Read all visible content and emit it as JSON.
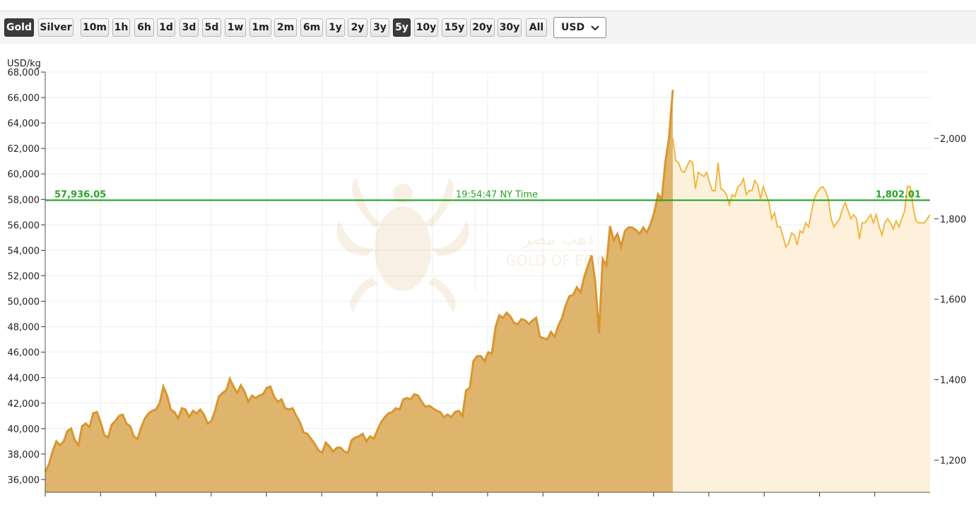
{
  "toolbar": {
    "metals": [
      {
        "label": "Gold",
        "active": true
      },
      {
        "label": "Silver",
        "active": false
      }
    ],
    "ranges": [
      {
        "label": "10m",
        "active": false
      },
      {
        "label": "1h",
        "active": false
      },
      {
        "label": "6h",
        "active": false
      },
      {
        "label": "1d",
        "active": false
      },
      {
        "label": "3d",
        "active": false
      },
      {
        "label": "5d",
        "active": false
      },
      {
        "label": "1w",
        "active": false
      },
      {
        "label": "1m",
        "active": false
      },
      {
        "label": "2m",
        "active": false
      },
      {
        "label": "6m",
        "active": false
      },
      {
        "label": "1y",
        "active": false
      },
      {
        "label": "2y",
        "active": false
      },
      {
        "label": "3y",
        "active": false
      },
      {
        "label": "5y",
        "active": true
      },
      {
        "label": "10y",
        "active": false
      },
      {
        "label": "15y",
        "active": false
      },
      {
        "label": "20y",
        "active": false
      },
      {
        "label": "30y",
        "active": false
      },
      {
        "label": "All",
        "active": false
      }
    ],
    "currency": "USD"
  },
  "watermark": {
    "arabic": "ذهب مصر",
    "english": "GOLD OF EGYPT"
  },
  "chart_data": {
    "type": "area",
    "ylabel": "USD/kg",
    "left_axis": {
      "ticks": [
        "36,000",
        "38,000",
        "40,000",
        "42,000",
        "44,000",
        "46,000",
        "48,000",
        "50,000",
        "52,000",
        "54,000",
        "56,000",
        "58,000",
        "60,000",
        "62,000",
        "64,000",
        "66,000",
        "68,000"
      ],
      "ylim": [
        35000,
        68000
      ]
    },
    "right_axis": {
      "ticks": [
        "1,200",
        "1,400",
        "1,600",
        "1,800",
        "2,000"
      ],
      "ylim": [
        1120,
        2165
      ]
    },
    "crosshair": {
      "left_value": "57,936.05",
      "right_value": "1,802.01",
      "time": "19:54:47 NY Time"
    },
    "x_tick_marks": 16,
    "colors": {
      "history_fill": "#dfb46c",
      "history_line": "#d9962f",
      "recent_fill": "#fdf1dc",
      "recent_line": "#f1b73f",
      "crosshair": "#1ea31e",
      "grid": "#eeeeee"
    },
    "series": [
      {
        "values": [
          36600,
          37200,
          38200,
          39000,
          38700,
          39000,
          39800,
          40000,
          39100,
          38700,
          40200,
          40400,
          40100,
          41200,
          41300,
          40500,
          39500,
          39300,
          40300,
          40600,
          41000,
          41100,
          40400,
          40200,
          39400,
          39200,
          40100,
          40800,
          41200,
          41400,
          41500,
          42000,
          43300,
          42600,
          41500,
          41300,
          40800,
          41600,
          41500,
          40900,
          41400,
          41200,
          41500,
          41100,
          40400,
          40600,
          41400,
          42500,
          42800,
          43000,
          43900,
          43300,
          42800,
          43400,
          42900,
          42100,
          42600,
          42400,
          42600,
          42700,
          43200,
          43300,
          42500,
          42100,
          42300,
          41600,
          41500,
          41600,
          41000,
          40500,
          39700,
          39600,
          39200,
          38800,
          38300,
          38100,
          38900,
          38600,
          38200,
          38500,
          38500,
          38200,
          38100,
          39100,
          39300,
          39400,
          39600,
          39000,
          39400,
          39200,
          39900,
          40500,
          40900,
          41200,
          41300,
          41600,
          41500,
          42300,
          42400,
          42300,
          42700,
          42600,
          42100,
          41700,
          41800,
          41600,
          41400,
          41300,
          40900,
          41100,
          40900,
          41300,
          41400,
          41000,
          43000,
          43200,
          45300,
          45700,
          45700,
          45300,
          46000,
          45900,
          48000,
          48900,
          48700,
          49100,
          48800,
          48300,
          48200,
          48600,
          48500,
          48200,
          48500,
          48700,
          47200,
          47100,
          47000,
          47600,
          47200,
          48100,
          48700,
          49700,
          50400,
          50500,
          51100,
          50700,
          51900,
          52800,
          53600,
          51500,
          47500,
          53300,
          52800,
          55900,
          54800,
          55300,
          54300,
          55500,
          55800,
          55800,
          55600,
          55300,
          55800,
          55400,
          56100,
          57000,
          58400,
          58000,
          61000,
          62900,
          66600
        ],
        "right_values": [
          2000,
          1945,
          1940,
          1920,
          1915,
          1930,
          1945,
          1940,
          1875,
          1915,
          1910,
          1905,
          1915,
          1890,
          1870,
          1870,
          1940,
          1875,
          1870,
          1860,
          1835,
          1860,
          1855,
          1880,
          1885,
          1900,
          1860,
          1870,
          1870,
          1895,
          1885,
          1850,
          1880,
          1860,
          1840,
          1800,
          1815,
          1780,
          1780,
          1755,
          1730,
          1740,
          1765,
          1760,
          1735,
          1770,
          1765,
          1790,
          1780,
          1815,
          1850,
          1865,
          1875,
          1880,
          1870,
          1850,
          1800,
          1780,
          1790,
          1800,
          1825,
          1840,
          1820,
          1800,
          1810,
          1800,
          1750,
          1790,
          1790,
          1800,
          1810,
          1790,
          1810,
          1780,
          1760,
          1790,
          1800,
          1790,
          1775,
          1795,
          1780,
          1800,
          1820,
          1880,
          1880,
          1830,
          1795,
          1790,
          1790,
          1790,
          1800,
          1810
        ]
      }
    ]
  }
}
